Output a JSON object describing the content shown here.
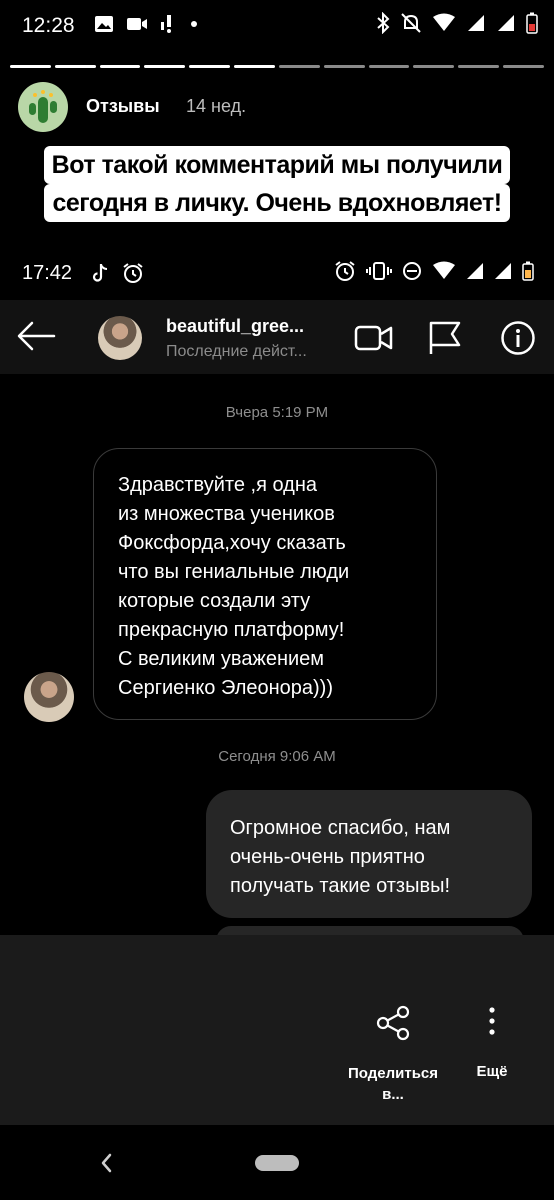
{
  "status_bar": {
    "time": "12:28"
  },
  "story": {
    "segments_total": 12,
    "segments_done": 6,
    "author": "Отзывы",
    "posted": "14 нед.",
    "caption_line1": "Вот такой комментарий мы получили",
    "caption_line2": "сегодня в личку. Очень вдохновляет!"
  },
  "screenshot": {
    "status_time": "17:42",
    "chat": {
      "username": "beautiful_gree...",
      "status": "Последние дейст..."
    },
    "messages": [
      {
        "timestamp": "Вчера 5:19 PM",
        "direction": "in",
        "lines": [
          "Здравствуйте ,я одна",
          "из множества учеников",
          "Фоксфорда,хочу сказать",
          "что вы гениальные люди",
          "которые создали эту",
          "прекрасную платформу!",
          "С великим уважением",
          "Сергиенко Элеонора)))"
        ]
      },
      {
        "timestamp": "Сегодня 9:06 AM",
        "direction": "out",
        "lines": [
          "Огромное спасибо, нам",
          "очень-очень приятно",
          "получать такие отзывы!"
        ]
      }
    ]
  },
  "sheet": {
    "share_label_1": "Поделиться",
    "share_label_2": "в...",
    "more_label": "Ещё"
  },
  "icons": {
    "accent": "#ffffff",
    "muted": "#8e8e8e"
  }
}
